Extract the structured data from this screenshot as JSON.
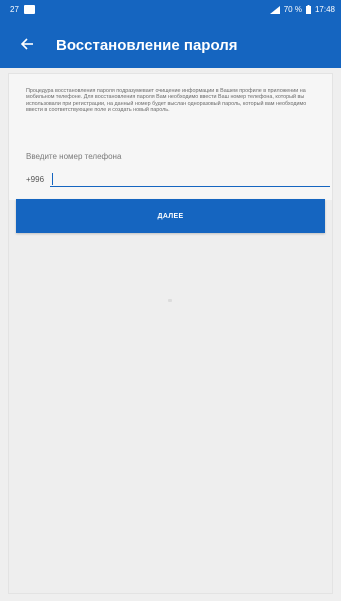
{
  "status_bar": {
    "notification_count": "27",
    "image_icon": "image-notification-icon",
    "signal_icon": "signal-icon",
    "battery_percent": "70 %",
    "battery_icon": "battery-icon",
    "time": "17:48"
  },
  "app_bar": {
    "back_icon": "back-arrow-icon",
    "title": "Восстановление пароля"
  },
  "form": {
    "info_text": "Процедура восстановления пароля подразумевает очищение информации в Вашем профиле в приложении на мобильном телефоне. Для восстановления пароля Вам необходимо ввести Ваш номер телефона, который вы использовали при регистрации, на данный номер будет выслан одноразовый пароль, который вам необходимо ввести в соответствующее поле и создать новый пароль.",
    "phone_label": "Введите номер телефона",
    "country_code": "+996",
    "phone_value": "",
    "phone_placeholder": ""
  },
  "next_button": {
    "label": "ДАЛЕЕ"
  },
  "colors": {
    "primary": "#1565c0",
    "background": "#efefef",
    "card": "#f6f6f6"
  }
}
